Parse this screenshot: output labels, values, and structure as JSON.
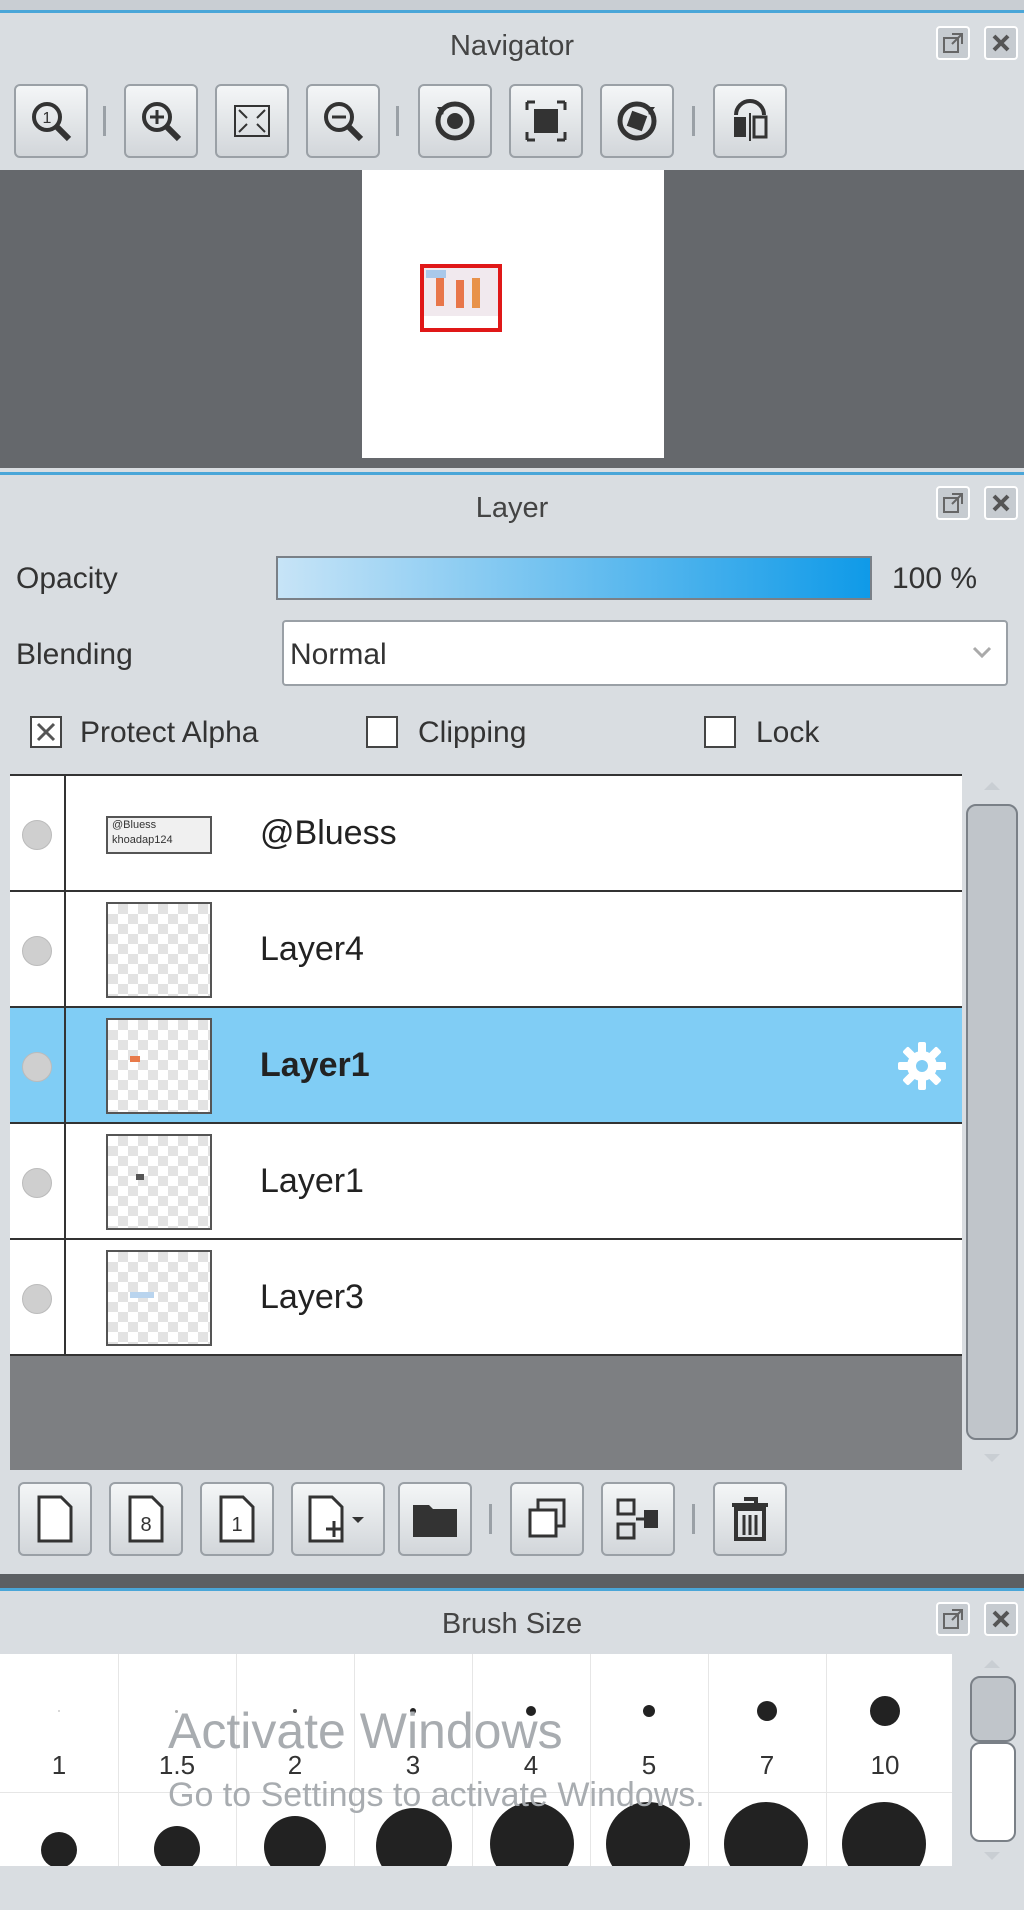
{
  "navigator": {
    "title": "Navigator",
    "tools": [
      "zoom-actual-size",
      "zoom-in",
      "fit-to-window",
      "zoom-out",
      "rotate-left",
      "reset-view",
      "rotate-right",
      "flip-horizontal"
    ]
  },
  "layer_panel": {
    "title": "Layer",
    "opacity_label": "Opacity",
    "opacity_value": "100 %",
    "opacity_fraction": 1.0,
    "blending_label": "Blending",
    "blending_value": "Normal",
    "protect_alpha_label": "Protect Alpha",
    "protect_alpha_checked": true,
    "clipping_label": "Clipping",
    "clipping_checked": false,
    "lock_label": "Lock",
    "lock_checked": false,
    "thumb_text_1": "@Bluess",
    "thumb_text_2": "khoadap124",
    "layers": [
      {
        "name": "@Bluess",
        "selected": false
      },
      {
        "name": "Layer4",
        "selected": false
      },
      {
        "name": "Layer1",
        "selected": true
      },
      {
        "name": "Layer1",
        "selected": false
      },
      {
        "name": "Layer3",
        "selected": false
      }
    ]
  },
  "brush_panel": {
    "title": "Brush Size",
    "sizes": [
      "1",
      "1.5",
      "2",
      "3",
      "4",
      "5",
      "7",
      "10"
    ]
  },
  "watermark": {
    "line1": "Activate Windows",
    "line2": "Go to Settings to activate Windows."
  },
  "colors": {
    "accent": "#4aa6d8",
    "selected_row": "#80cdf5"
  }
}
